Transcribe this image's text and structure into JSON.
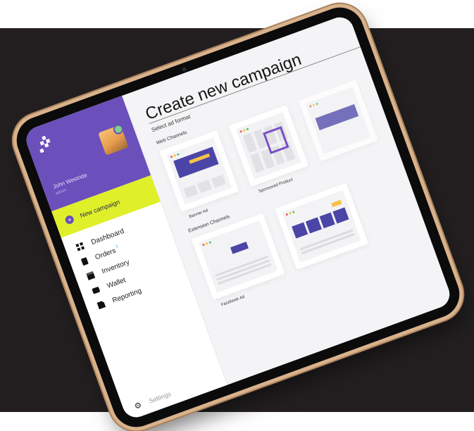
{
  "sidebar": {
    "user_name": "John Westride",
    "user_role": "admin",
    "new_campaign_label": "New campaign",
    "items": [
      {
        "label": "Dashboard"
      },
      {
        "label": "Orders",
        "badge": "1"
      },
      {
        "label": "Inventory"
      },
      {
        "label": "Wallet"
      },
      {
        "label": "Reporting"
      }
    ],
    "settings_label": "Settings"
  },
  "main": {
    "title": "Create new campaign",
    "subtitle": "Select ad format",
    "sections": [
      {
        "label": "Web Channels",
        "cards": [
          {
            "caption": "Banner Ad"
          },
          {
            "caption": "Sponsored Product"
          }
        ]
      },
      {
        "label": "Extension Channels",
        "cards": [
          {
            "caption": "Facebook Ad"
          }
        ]
      }
    ]
  },
  "colors": {
    "backdrop": "#231f20",
    "brand_purple": "#6b4fbb",
    "accent_yellow": "#dff02a",
    "ad_blue": "#4b45a8",
    "frame_gold": "#d9b28c"
  }
}
